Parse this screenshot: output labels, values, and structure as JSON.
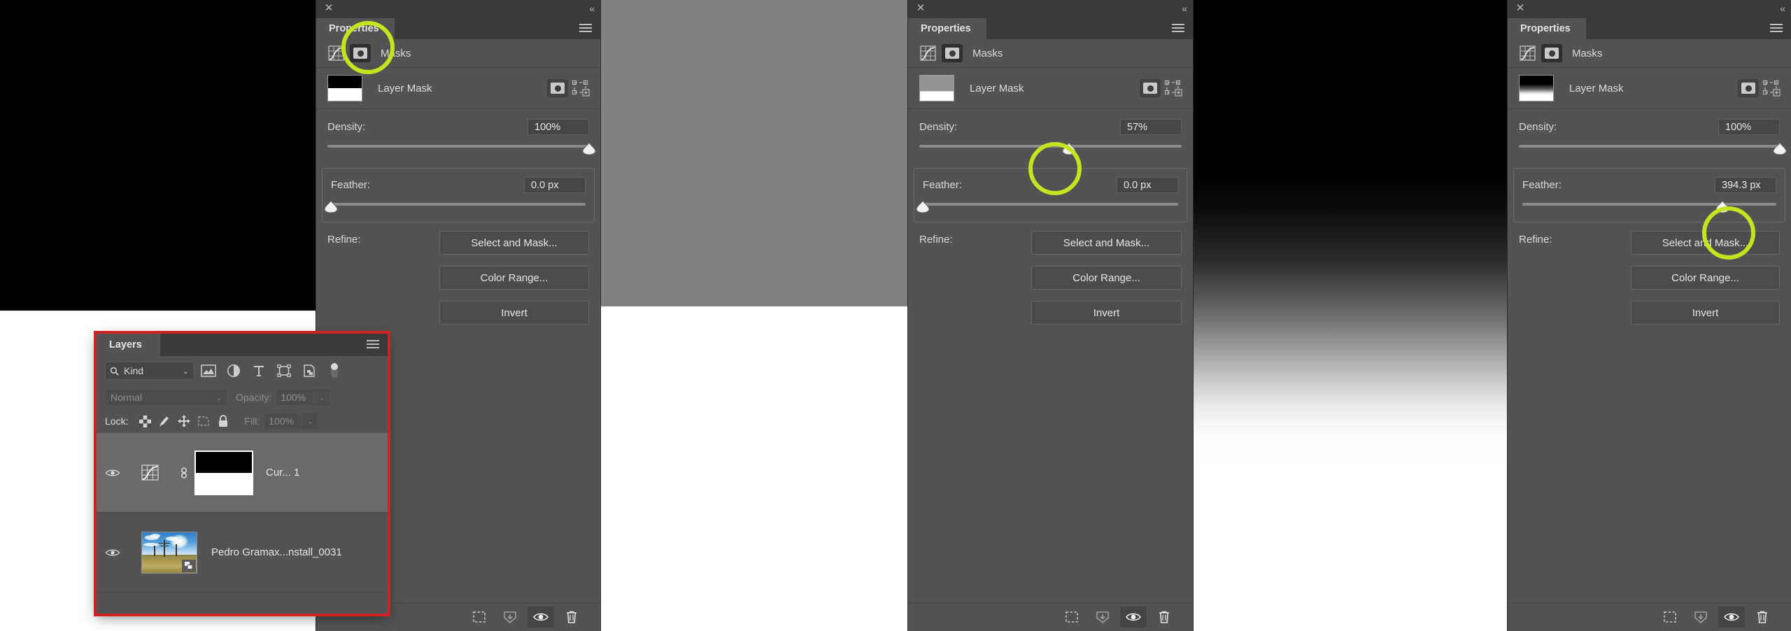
{
  "app": "Adobe Photoshop — Layer Mask Properties",
  "canvases": [
    {
      "name": "hard-edge-mask-canvas",
      "description": "black top / white bottom, hard edge"
    },
    {
      "name": "density-57-canvas",
      "description": "gray top / white bottom, density 57%"
    },
    {
      "name": "feathered-mask-canvas",
      "description": "black to white vertical gradient, feathered"
    }
  ],
  "properties_panels": [
    {
      "title": "Properties",
      "close_label": "✕",
      "collapse_label": "«",
      "menu_label": "panel-menu",
      "masks_label": "Masks",
      "layer_mask_label": "Layer Mask",
      "density": {
        "label": "Density:",
        "value": "100%",
        "percent": 100
      },
      "feather": {
        "label": "Feather:",
        "value": "0.0 px",
        "percent": 0
      },
      "refine": {
        "label": "Refine:"
      },
      "buttons": {
        "select_and_mask": "Select and Mask...",
        "color_range": "Color Range...",
        "invert": "Invert"
      },
      "bottom_icons": [
        "selection-icon",
        "apply-mask-icon",
        "toggle-mask-visibility-icon",
        "delete-mask-icon"
      ],
      "highlight": "masks-tab-icon"
    },
    {
      "title": "Properties",
      "close_label": "✕",
      "collapse_label": "«",
      "menu_label": "panel-menu",
      "masks_label": "Masks",
      "layer_mask_label": "Layer Mask",
      "density": {
        "label": "Density:",
        "value": "57%",
        "percent": 57
      },
      "feather": {
        "label": "Feather:",
        "value": "0.0 px",
        "percent": 0
      },
      "refine": {
        "label": "Refine:"
      },
      "buttons": {
        "select_and_mask": "Select and Mask...",
        "color_range": "Color Range...",
        "invert": "Invert"
      },
      "bottom_icons": [
        "selection-icon",
        "apply-mask-icon",
        "toggle-mask-visibility-icon",
        "delete-mask-icon"
      ],
      "highlight": "density-slider-thumb"
    },
    {
      "title": "Properties",
      "close_label": "✕",
      "collapse_label": "«",
      "menu_label": "panel-menu",
      "masks_label": "Masks",
      "layer_mask_label": "Layer Mask",
      "density": {
        "label": "Density:",
        "value": "100%",
        "percent": 100
      },
      "feather": {
        "label": "Feather:",
        "value": "394.3 px",
        "percent": 80
      },
      "refine": {
        "label": "Refine:"
      },
      "buttons": {
        "select_and_mask": "Select and Mask...",
        "color_range": "Color Range...",
        "invert": "Invert"
      },
      "bottom_icons": [
        "selection-icon",
        "apply-mask-icon",
        "toggle-mask-visibility-icon",
        "delete-mask-icon"
      ],
      "highlight": "feather-slider-thumb"
    }
  ],
  "layers_panel": {
    "title": "Layers",
    "menu_label": "panel-menu",
    "filter": {
      "kind_label": "Kind",
      "search_icon": "search-icon",
      "chevron": "⌄",
      "icons": [
        "pixel-layer-filter-icon",
        "adjustment-layer-filter-icon",
        "type-layer-filter-icon",
        "shape-layer-filter-icon",
        "smart-object-filter-icon",
        "filter-toggle-switch"
      ]
    },
    "blend": {
      "mode": "Normal",
      "chevron": "⌄",
      "opacity_label": "Opacity:",
      "opacity_value": "100%"
    },
    "lock": {
      "label": "Lock:",
      "icons": [
        "lock-transparent-pixels-icon",
        "lock-image-pixels-icon",
        "lock-position-icon",
        "lock-artboard-nesting-icon",
        "lock-all-icon"
      ],
      "fill_label": "Fill:",
      "fill_value": "100%"
    },
    "rows": [
      {
        "name": "Cur... 1",
        "kind": "curves-adjustment-layer",
        "visible": true,
        "selected": true,
        "linked": true,
        "mask": "black-top-white-bottom"
      },
      {
        "name": "Pedro Gramax...nstall_0031",
        "kind": "smart-object-layer",
        "visible": true,
        "selected": false,
        "linked": false,
        "mask": null
      }
    ]
  },
  "colors": {
    "panel_bg": "#535353",
    "panel_header_bg": "#3a3a3a",
    "highlight_ring": "#c3e41e",
    "layers_panel_outline": "#cf2222",
    "text": "#d6d6d6"
  }
}
